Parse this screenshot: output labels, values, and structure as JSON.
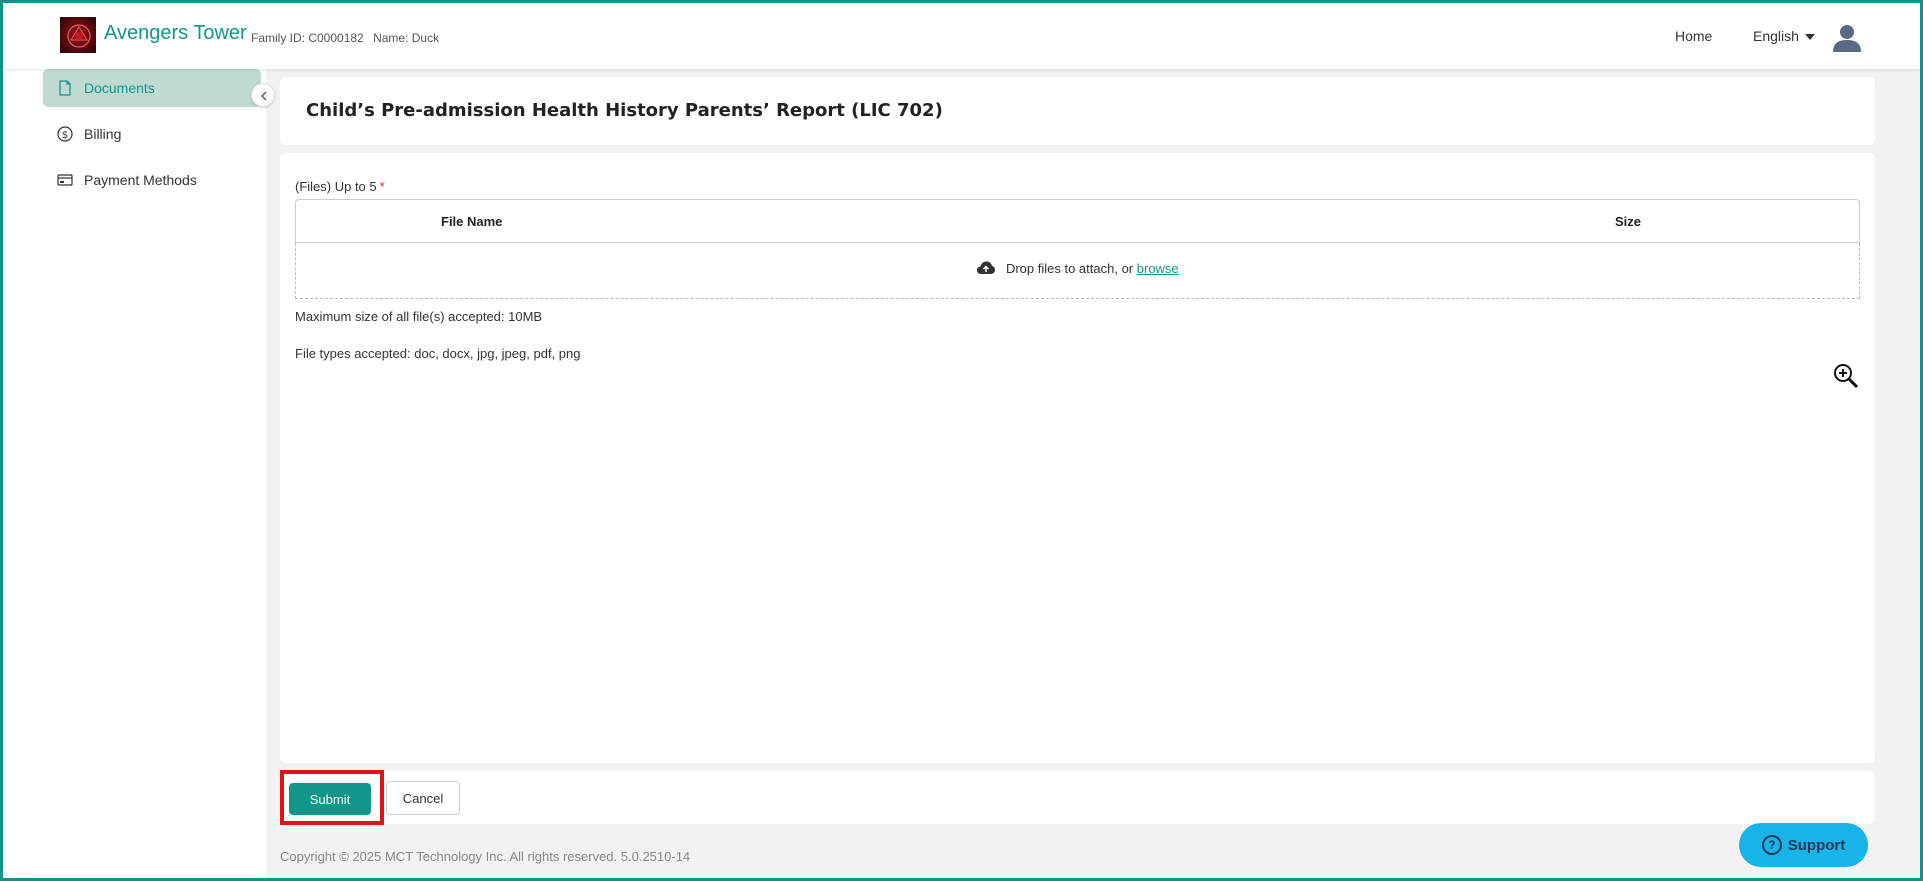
{
  "header": {
    "app_title": "Avengers Tower",
    "family_id": "Family ID: C0000182",
    "name": "Name: Duck",
    "home_label": "Home",
    "language": "English"
  },
  "sidebar": {
    "items": [
      {
        "label": "Documents",
        "icon": "document-icon",
        "active": true
      },
      {
        "label": "Billing",
        "icon": "dollar-icon",
        "active": false
      },
      {
        "label": "Payment Methods",
        "icon": "card-icon",
        "active": false
      }
    ]
  },
  "form": {
    "title": "Child’s Pre-admission Health History Parents’ Report (LIC 702)",
    "files_label": "(Files) Up to 5",
    "required_mark": "*",
    "columns": {
      "file_name": "File Name",
      "size": "Size"
    },
    "dropzone_text": "Drop files to attach, or",
    "browse_label": "browse",
    "max_size_note": "Maximum size of all file(s) accepted: 10MB",
    "file_types_note": "File types accepted: doc, docx, jpg, jpeg, pdf, png"
  },
  "actions": {
    "submit_label": "Submit",
    "cancel_label": "Cancel"
  },
  "footer": {
    "copyright": "Copyright © 2025 MCT Technology Inc. All rights reserved. 5.0.2510-14"
  },
  "support": {
    "label": "Support",
    "icon_glyph": "?"
  },
  "colors": {
    "accent": "#14958a",
    "highlight": "#e0131b",
    "support": "#18b4e8"
  }
}
